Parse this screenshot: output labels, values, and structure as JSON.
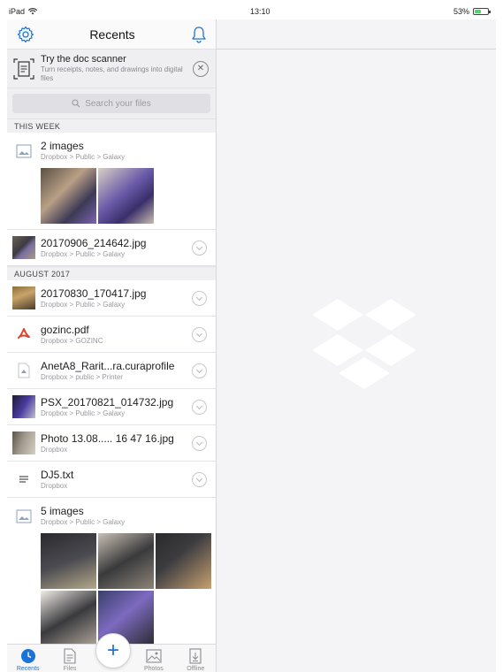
{
  "status": {
    "device": "iPad",
    "time": "13:10",
    "battery": "53%",
    "battery_level": 0.53
  },
  "header": {
    "title": "Recents"
  },
  "promo": {
    "title": "Try the doc scanner",
    "subtitle": "Turn receipts, notes, and drawings into digital files"
  },
  "search": {
    "placeholder": "Search your files"
  },
  "sections": [
    {
      "label": "THIS WEEK",
      "items": [
        {
          "name": "2 images",
          "path": "Dropbox > Public > Galaxy",
          "kind": "image-group",
          "icon": "image-group-icon",
          "photo_count": 2
        },
        {
          "name": "20170906_214642.jpg",
          "path": "Dropbox > Public > Galaxy",
          "kind": "photo",
          "icon": "photo-thumb"
        }
      ]
    },
    {
      "label": "AUGUST 2017",
      "items": [
        {
          "name": "20170830_170417.jpg",
          "path": "Dropbox > Public > Galaxy",
          "kind": "photo",
          "icon": "photo-thumb"
        },
        {
          "name": "gozinc.pdf",
          "path": "Dropbox > GOZINC",
          "kind": "pdf",
          "icon": "pdf-icon"
        },
        {
          "name": "AnetA8_Rarit...ra.curaprofile",
          "path": "Dropbox > public > Printer",
          "kind": "file",
          "icon": "generic-file-icon"
        },
        {
          "name": "PSX_20170821_014732.jpg",
          "path": "Dropbox > Public > Galaxy",
          "kind": "photo",
          "icon": "photo-thumb"
        },
        {
          "name": "Photo 13.08..... 16 47 16.jpg",
          "path": "Dropbox",
          "kind": "photo",
          "icon": "photo-thumb"
        },
        {
          "name": "DJ5.txt",
          "path": "Dropbox",
          "kind": "text",
          "icon": "text-file-icon"
        },
        {
          "name": "5 images",
          "path": "Dropbox > Public > Galaxy",
          "kind": "image-group",
          "icon": "image-group-icon",
          "photo_count": 5
        }
      ]
    }
  ],
  "tabs": [
    {
      "label": "Recents",
      "icon": "clock-icon",
      "active": true
    },
    {
      "label": "Files",
      "icon": "files-icon",
      "active": false
    },
    {
      "label": "Photos",
      "icon": "photos-icon",
      "active": false
    },
    {
      "label": "Offline",
      "icon": "offline-icon",
      "active": false
    }
  ],
  "colors": {
    "accent": "#1a73d9",
    "pdf": "#e0442e",
    "battery": "#4cd964"
  }
}
